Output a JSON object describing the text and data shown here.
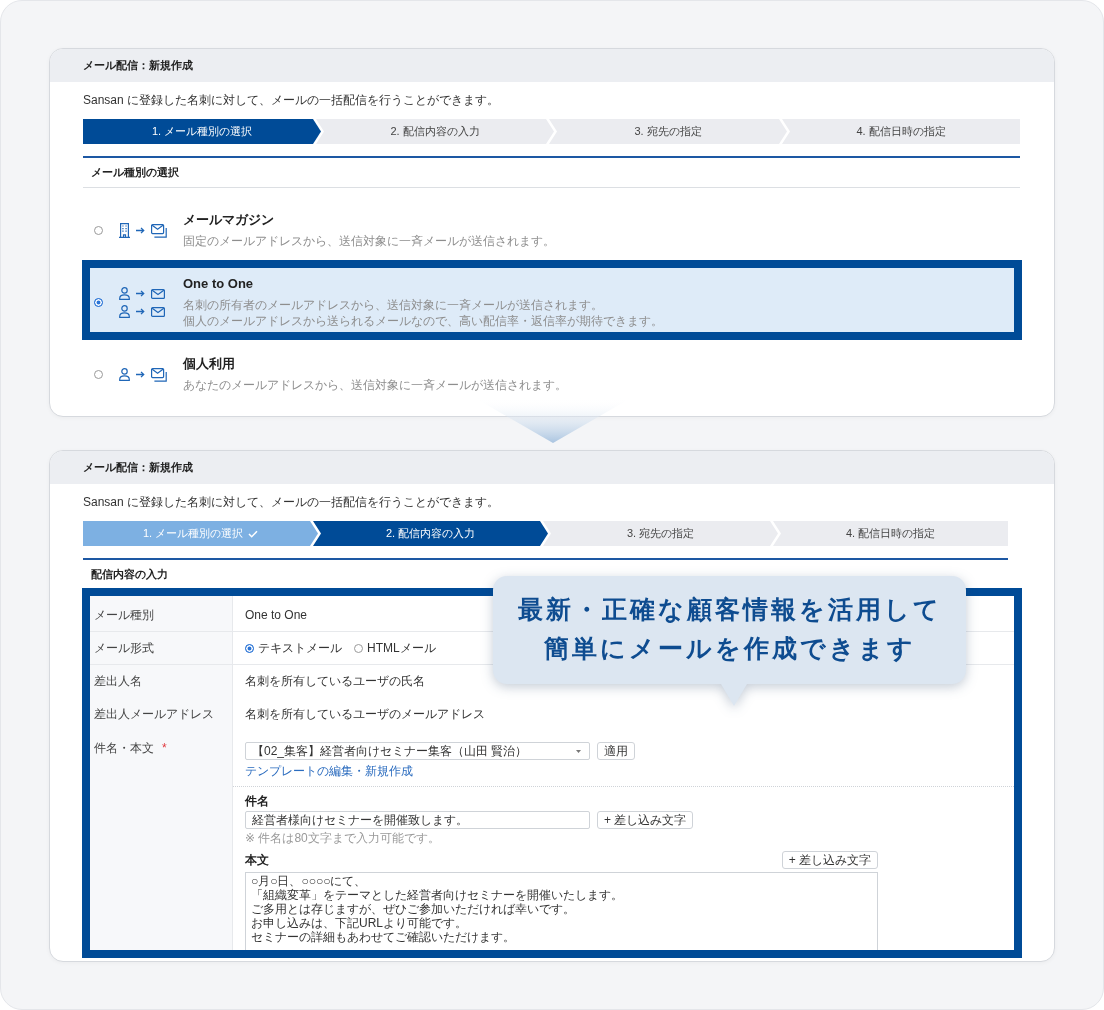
{
  "type_selection_panel": {
    "title": "メール配信：新規作成",
    "description": "Sansan に登録した名刺に対して、メールの一括配信を行うことができます。",
    "steps": [
      {
        "label": "1. メール種別の選択",
        "selected": true,
        "completed": false
      },
      {
        "label": "2. 配信内容の入力",
        "selected": false,
        "completed": false
      },
      {
        "label": "3. 宛先の指定",
        "selected": false,
        "completed": false
      },
      {
        "label": "4. 配信日時の指定",
        "selected": false,
        "completed": false
      }
    ],
    "section_title": "メール種別の選択",
    "options": [
      {
        "kind": "magazine",
        "title": "メールマガジン",
        "description": [
          "固定のメールアドレスから、送信対象に一斉メールが送信されます。"
        ],
        "selected": false
      },
      {
        "kind": "one_to_one",
        "title": "One to One",
        "description": [
          "名刺の所有者のメールアドレスから、送信対象に一斉メールが送信されます。",
          "個人のメールアドレスから送られるメールなので、高い配信率・返信率が期待できます。"
        ],
        "selected": true
      },
      {
        "kind": "personal",
        "title": "個人利用",
        "description": [
          "あなたのメールアドレスから、送信対象に一斉メールが送信されます。"
        ],
        "selected": false
      }
    ]
  },
  "content_input_panel": {
    "title": "メール配信：新規作成",
    "description": "Sansan に登録した名刺に対して、メールの一括配信を行うことができます。",
    "steps": [
      {
        "label": "1. メール種別の選択",
        "selected": false,
        "completed": true
      },
      {
        "label": "2. 配信内容の入力",
        "selected": true,
        "completed": false
      },
      {
        "label": "3. 宛先の指定",
        "selected": false,
        "completed": false
      },
      {
        "label": "4. 配信日時の指定",
        "selected": false,
        "completed": false
      }
    ],
    "section_title": "配信内容の入力",
    "form": {
      "rows": [
        {
          "kind": "text",
          "label": "メール種別",
          "value": "One to One"
        },
        {
          "kind": "radios",
          "label": "メール形式",
          "options": [
            {
              "label": "テキストメール",
              "selected": true
            },
            {
              "label": "HTMLメール",
              "selected": false
            }
          ]
        },
        {
          "kind": "text",
          "label": "差出人名",
          "value": "名刺を所有しているユーザの氏名"
        },
        {
          "kind": "text",
          "label": "差出人メールアドレス",
          "value": "名刺を所有しているユーザのメールアドレス"
        },
        {
          "kind": "template",
          "label": "件名・本文",
          "required_mark": "*",
          "template_select": "【02_集客】経営者向けセミナー集客（山田 賢治）",
          "apply_button": "適用",
          "template_link": "テンプレートの編集・新規作成",
          "subject": {
            "heading": "件名",
            "value": "経営者様向けセミナーを開催致します。",
            "insert_button": "+ 差し込み文字",
            "note": "※ 件名は80文字まで入力可能です。"
          },
          "body": {
            "heading": "本文",
            "insert_button": "+ 差し込み文字",
            "lines": [
              "○月○日、○○○○にて、",
              "「組織変革」をテーマとした経営者向けセミナーを開催いたします。",
              "ご多用とは存じますが、ぜひご参加いただければ幸いです。",
              "お申し込みは、下記URLより可能です。",
              "セミナーの詳細もあわせてご確認いただけます。"
            ]
          }
        }
      ]
    },
    "callout": {
      "lines": [
        "最新・正確な顧客情報を活用して",
        "簡単にメールを作成できます"
      ]
    }
  }
}
